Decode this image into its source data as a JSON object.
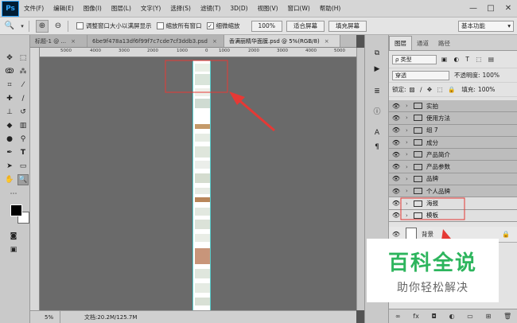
{
  "menubar": {
    "logo": "Ps",
    "items": [
      "文件(F)",
      "编辑(E)",
      "图像(I)",
      "图层(L)",
      "文字(Y)",
      "选择(S)",
      "滤镜(T)",
      "3D(D)",
      "视图(V)",
      "窗口(W)",
      "帮助(H)"
    ],
    "min": "—",
    "max": "□",
    "close": "✕"
  },
  "options": {
    "chk_resize": "调整窗口大小以满屏显示",
    "chk_all": "缩放所有窗口",
    "chk_scrubby": "细微缩放",
    "zoom_btn": "100%",
    "fit_btn": "适合屏幕",
    "fill_btn": "填充屏幕",
    "workspace": "基本功能"
  },
  "tabs": [
    {
      "label": "标题-1 @ ...",
      "close": "×"
    },
    {
      "label": "6be9f478a13df6f99f7c7cde7cf3ddb3.psd",
      "close": "×"
    },
    {
      "label": "香满丽精华面膜.psd @ 5%(RGB/8)",
      "close": "×"
    }
  ],
  "ruler": [
    "5000",
    "4000",
    "3000",
    "2000",
    "1000",
    "0",
    "1000",
    "2000",
    "3000",
    "4000",
    "5000"
  ],
  "status": {
    "zoom": "5%",
    "doc": "文档:20.2M/125.7M"
  },
  "panel": {
    "tabs": [
      "图层",
      "通道",
      "路径"
    ],
    "filter_label": "ρ 类型",
    "blend": "穿透",
    "opacity_label": "不透明度:",
    "opacity": "100%",
    "lock_label": "锁定:",
    "fill_label": "填充:",
    "fill": "100%"
  },
  "layers": [
    {
      "name": "实拍"
    },
    {
      "name": "使用方法"
    },
    {
      "name": "组 7"
    },
    {
      "name": "成分"
    },
    {
      "name": "产品简介"
    },
    {
      "name": "产品参数"
    },
    {
      "name": "品牌"
    },
    {
      "name": "个人品牌"
    },
    {
      "name": "海报"
    },
    {
      "name": "模板"
    }
  ],
  "background_layer": "背景",
  "watermark": {
    "title": "百科全说",
    "subtitle": "助你轻松解决"
  },
  "colors": {
    "annotation": "#e53935",
    "watermark_green": "#2db55d"
  }
}
